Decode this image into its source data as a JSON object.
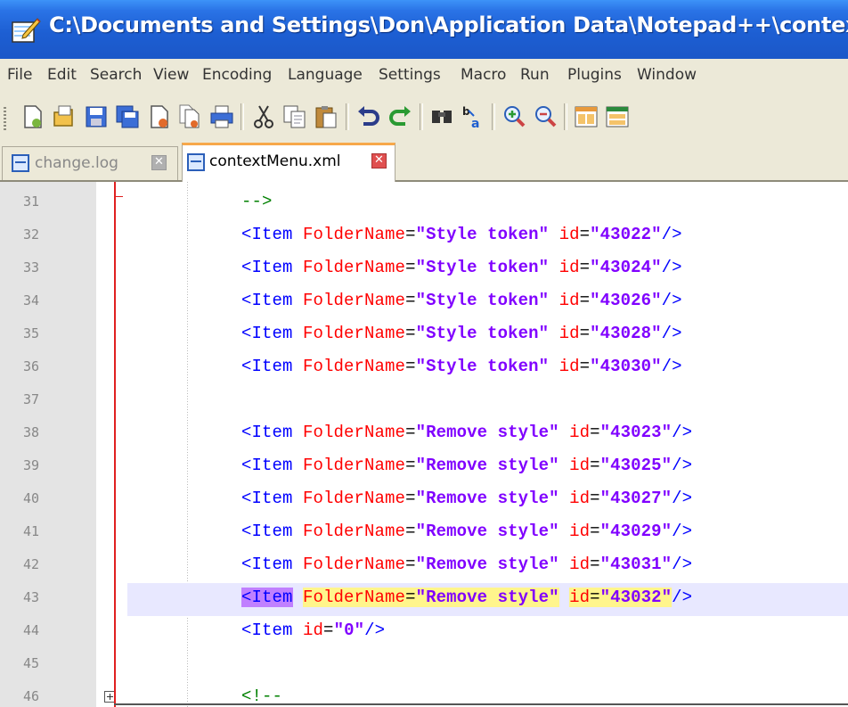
{
  "window": {
    "title": "C:\\Documents and Settings\\Don\\Application Data\\Notepad++\\contextMen"
  },
  "menubar": [
    "File",
    "Edit",
    "Search",
    "View",
    "Encoding",
    "Language",
    "Settings",
    "Macro",
    "Run",
    "Plugins",
    "Window"
  ],
  "toolbar": {
    "buttons": [
      "new-file-icon",
      "open-file-icon",
      "save-icon",
      "save-all-icon",
      "close-icon",
      "close-all-icon",
      "print-icon",
      "cut-icon",
      "copy-icon",
      "paste-icon",
      "undo-icon",
      "redo-icon",
      "find-icon",
      "replace-icon",
      "zoom-in-icon",
      "zoom-out-icon",
      "sync-v-icon",
      "sync-h-icon"
    ]
  },
  "tabs": [
    {
      "label": "change.log",
      "active": false
    },
    {
      "label": "contextMenu.xml",
      "active": true
    }
  ],
  "editor": {
    "lines": [
      {
        "num": "31",
        "text": "-->"
      },
      {
        "num": "32",
        "text": "<Item FolderName=\"Style token\" id=\"43022\"/>"
      },
      {
        "num": "33",
        "text": "<Item FolderName=\"Style token\" id=\"43024\"/>"
      },
      {
        "num": "34",
        "text": "<Item FolderName=\"Style token\" id=\"43026\"/>"
      },
      {
        "num": "35",
        "text": "<Item FolderName=\"Style token\" id=\"43028\"/>"
      },
      {
        "num": "36",
        "text": "<Item FolderName=\"Style token\" id=\"43030\"/>"
      },
      {
        "num": "37",
        "text": ""
      },
      {
        "num": "38",
        "text": "<Item FolderName=\"Remove style\" id=\"43023\"/>"
      },
      {
        "num": "39",
        "text": "<Item FolderName=\"Remove style\" id=\"43025\"/>"
      },
      {
        "num": "40",
        "text": "<Item FolderName=\"Remove style\" id=\"43027\"/>"
      },
      {
        "num": "41",
        "text": "<Item FolderName=\"Remove style\" id=\"43029\"/>"
      },
      {
        "num": "42",
        "text": "<Item FolderName=\"Remove style\" id=\"43031\"/>"
      },
      {
        "num": "43",
        "text": "<Item FolderName=\"Remove style\" id=\"43032\"/>"
      },
      {
        "num": "44",
        "text": "<Item id=\"0\"/>"
      },
      {
        "num": "45",
        "text": ""
      },
      {
        "num": "46",
        "text": "<!--"
      }
    ],
    "current_line": "43",
    "colors": {
      "tag": "#0000ff",
      "attr": "#ff0000",
      "value": "#8000ff",
      "comment": "#008000"
    }
  }
}
